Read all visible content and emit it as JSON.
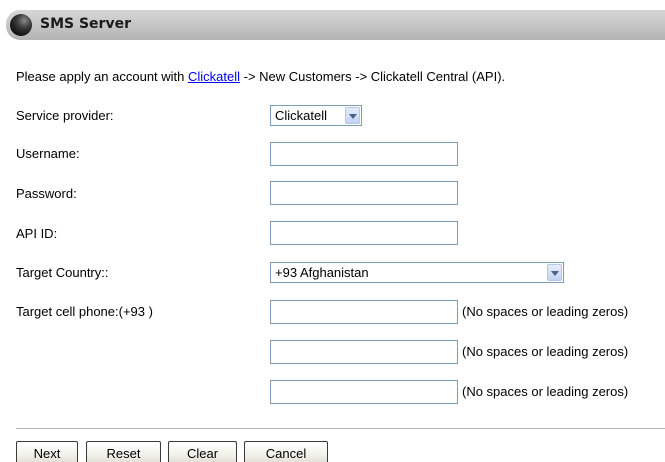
{
  "header": {
    "title": "SMS Server"
  },
  "intro": {
    "prefix": "Please apply an account with ",
    "link": "Clickatell",
    "suffix": " -> New Customers -> Clickatell Central (API)."
  },
  "form": {
    "service_provider": {
      "label": "Service provider:",
      "value": "Clickatell"
    },
    "username": {
      "label": "Username:",
      "value": ""
    },
    "password": {
      "label": "Password:",
      "value": ""
    },
    "api_id": {
      "label": "API ID:",
      "value": ""
    },
    "target_country": {
      "label": "Target Country::",
      "value": "+93 Afghanistan"
    },
    "target_phone": {
      "label": "Target cell phone:(+93 )",
      "hint": "(No spaces or leading zeros)",
      "values": [
        "",
        "",
        ""
      ]
    }
  },
  "buttons": {
    "next": "Next",
    "reset": "Reset",
    "clear": "Clear",
    "cancel": "Cancel"
  }
}
